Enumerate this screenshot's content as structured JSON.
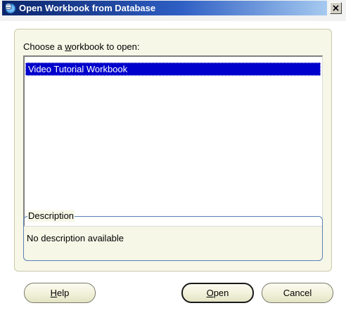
{
  "window": {
    "title": "Open Workbook from Database",
    "title_icon": "database-globe-icon",
    "close_glyph": "×"
  },
  "main": {
    "choose_label": {
      "before": "Choose a ",
      "mnemonic": "w",
      "after": "orkbook to open:"
    },
    "workbooks": [
      {
        "name": "Video Tutorial Workbook",
        "selected": true
      }
    ],
    "description": {
      "legend": "Description",
      "text": "No description available"
    }
  },
  "buttons": {
    "help": {
      "mnemonic": "H",
      "rest": "elp"
    },
    "open": {
      "mnemonic": "O",
      "rest": "pen",
      "is_default": true
    },
    "cancel": {
      "label": "Cancel"
    }
  },
  "colors": {
    "selection": "#0000cc",
    "panel_background": "#f7f7e7",
    "group_border": "#5a7fb4",
    "titlebar_start": "#0a246a",
    "titlebar_end": "#a6caf0"
  }
}
